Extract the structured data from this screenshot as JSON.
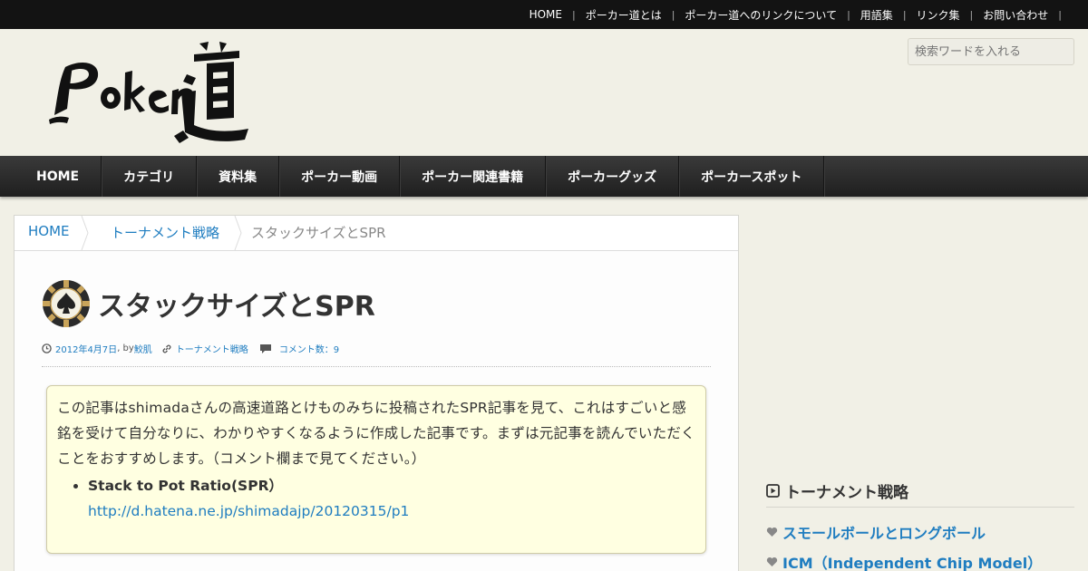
{
  "top_nav": [
    "HOME",
    "ポーカー道とは",
    "ポーカー道へのリンクについて",
    "用語集",
    "リンク集",
    "お問い合わせ"
  ],
  "search": {
    "placeholder": "検索ワードを入れる"
  },
  "logo_text": "Poker道",
  "main_nav": [
    "HOME",
    "カテゴリ",
    "資料集",
    "ポーカー動画",
    "ポーカー関連書籍",
    "ポーカーグッズ",
    "ポーカースポット"
  ],
  "breadcrumb": {
    "home": "HOME",
    "category": "トーナメント戦略",
    "current": "スタックサイズとSPR"
  },
  "post": {
    "title": "スタックサイズとSPR",
    "date": "2012年4月7日",
    "by": " , by ",
    "author": "鮫肌",
    "category": "トーナメント戦略",
    "comments": "コメント数：9"
  },
  "note": {
    "text": "この記事はshimadaさんの高速道路とけものみちに投稿されたSPR記事を見て、これはすごいと感銘を受けて自分なりに、わかりやすくなるように作成した記事です。まずは元記事を読んでいただくことをおすすめします。（コメント欄まで見てください。）",
    "item_title": "Stack to Pot Ratio(SPR）",
    "item_url": "http://d.hatena.ne.jp/shimadajp/20120315/p1"
  },
  "sidebar": {
    "widget_title": "トーナメント戦略",
    "items": [
      "スモールボールとロングボール",
      "ICM（Independent Chip Model）"
    ]
  },
  "colors": {
    "link": "#1f7dc0",
    "topbar": "#131313",
    "background": "#f1f0e6",
    "note_bg": "#ffffe1"
  }
}
